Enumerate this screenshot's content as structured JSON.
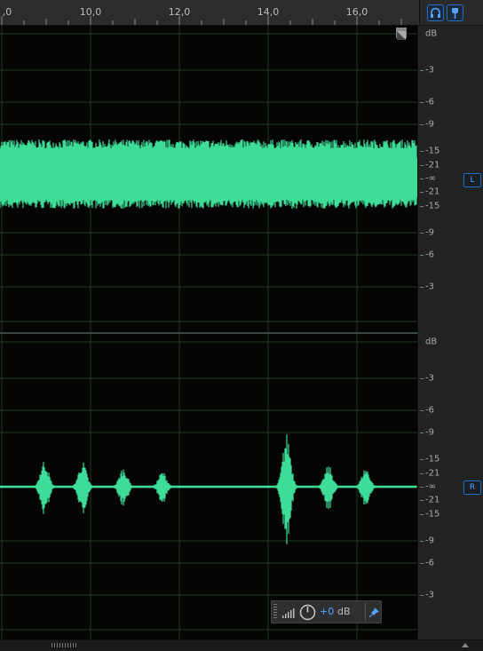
{
  "ruler": {
    "labels": [
      ",0",
      "10,0",
      "12,0",
      "14,0",
      "16,0"
    ]
  },
  "toolbar": {
    "headphones_icon": "headphones-icon",
    "marker_icon": "marker-pin-icon"
  },
  "channels": [
    {
      "id": "L",
      "badge": "L",
      "db_scale": [
        "dB",
        "-3",
        "-6",
        "-9",
        "-15",
        "-21",
        "-∞",
        "-21",
        "-15",
        "-9",
        "-6",
        "-3"
      ]
    },
    {
      "id": "R",
      "badge": "R",
      "db_scale": [
        "dB",
        "-3",
        "-6",
        "-9",
        "-15",
        "-21",
        "-∞",
        "-21",
        "-15",
        "-9",
        "-6",
        "-3"
      ]
    }
  ],
  "hud": {
    "volume_value": "+0",
    "volume_unit": "dB",
    "icons": [
      "level-meter-icon",
      "volume-knob-icon",
      "pin-icon"
    ]
  },
  "colors": {
    "waveform": "#3ddc97",
    "background": "#050505",
    "grid": "#1f3a1f",
    "accent": "#1f6fc7"
  }
}
